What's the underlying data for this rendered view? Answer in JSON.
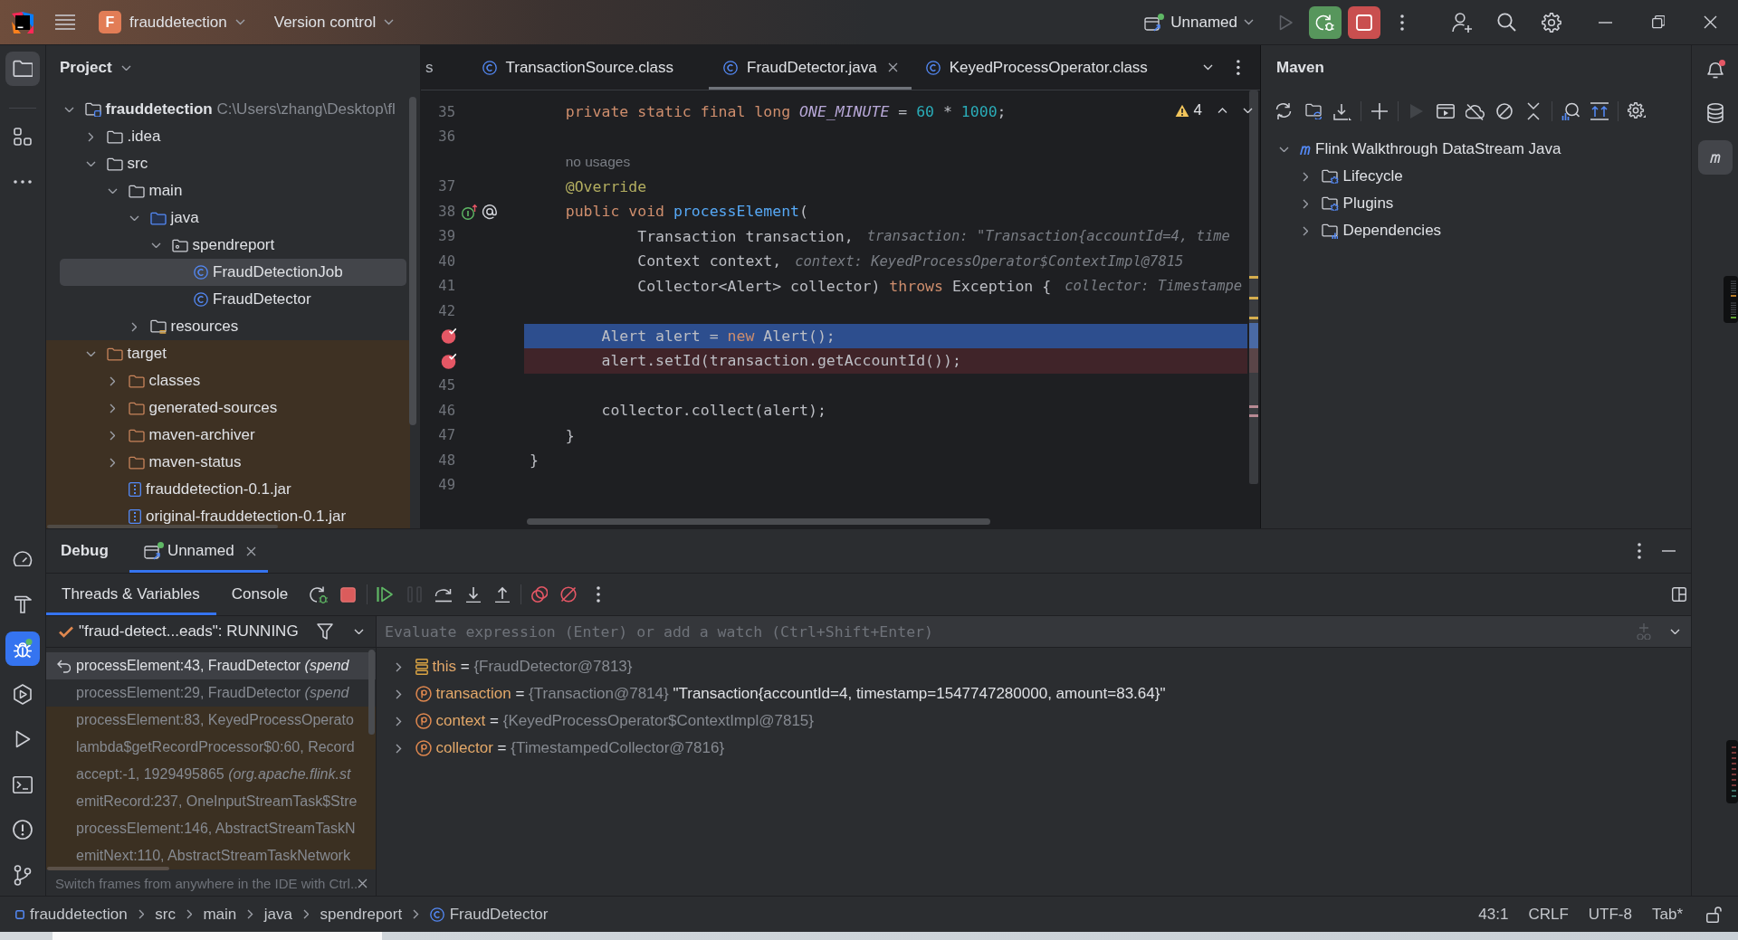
{
  "title_bar": {
    "project_badge": "F",
    "project": "frauddetection",
    "vcs": "Version control",
    "run_config": "Unnamed",
    "run_actions": [
      {
        "kind": "run",
        "disabled": true
      },
      {
        "kind": "debug",
        "disabled": false
      },
      {
        "kind": "stop",
        "disabled": false
      }
    ]
  },
  "left_toolbar": {
    "top": [
      {
        "kind": "project",
        "selected": true
      },
      {
        "kind": "structure",
        "selected": false
      },
      {
        "kind": "more",
        "selected": false
      }
    ],
    "bottom": [
      {
        "kind": "profiler",
        "selected": false
      },
      {
        "kind": "build",
        "selected": false
      },
      {
        "kind": "debug",
        "selected": true
      },
      {
        "kind": "services",
        "selected": false
      },
      {
        "kind": "run",
        "selected": false
      },
      {
        "kind": "terminal",
        "selected": false
      },
      {
        "kind": "problems",
        "selected": false
      },
      {
        "kind": "git",
        "selected": false
      }
    ]
  },
  "project": {
    "title": "Project",
    "tree": [
      {
        "label": "frauddetection",
        "path": "C:\\Users\\zhang\\Desktop\\fl",
        "kind": "module",
        "expanded": true,
        "selected": false,
        "excluded": false,
        "children": [
          {
            "label": ".idea",
            "kind": "folder",
            "expanded": false,
            "selected": false,
            "excluded": false
          },
          {
            "label": "src",
            "kind": "folder",
            "expanded": true,
            "selected": false,
            "excluded": false,
            "children": [
              {
                "label": "main",
                "kind": "folder",
                "expanded": true,
                "selected": false,
                "excluded": false,
                "children": [
                  {
                    "label": "java",
                    "kind": "source",
                    "expanded": true,
                    "selected": false,
                    "excluded": false,
                    "children": [
                      {
                        "label": "spendreport",
                        "kind": "package",
                        "expanded": true,
                        "selected": false,
                        "excluded": false,
                        "children": [
                          {
                            "label": "FraudDetectionJob",
                            "kind": "class",
                            "selected": true,
                            "excluded": false
                          },
                          {
                            "label": "FraudDetector",
                            "kind": "class",
                            "selected": false,
                            "excluded": false
                          }
                        ]
                      }
                    ]
                  },
                  {
                    "label": "resources",
                    "kind": "resources",
                    "expanded": false,
                    "selected": false,
                    "excluded": false
                  }
                ]
              }
            ]
          },
          {
            "label": "target",
            "kind": "folder",
            "expanded": true,
            "selected": false,
            "excluded": true,
            "children": [
              {
                "label": "classes",
                "kind": "folder",
                "expanded": false,
                "selected": false,
                "excluded": true
              },
              {
                "label": "generated-sources",
                "kind": "folder",
                "expanded": false,
                "selected": false,
                "excluded": true
              },
              {
                "label": "maven-archiver",
                "kind": "folder",
                "expanded": false,
                "selected": false,
                "excluded": true
              },
              {
                "label": "maven-status",
                "kind": "folder",
                "expanded": false,
                "selected": false,
                "excluded": true
              },
              {
                "label": "frauddetection-0.1.jar",
                "kind": "jar",
                "selected": false,
                "excluded": true
              },
              {
                "label": "original-frauddetection-0.1.jar",
                "kind": "jar",
                "selected": false,
                "excluded": true
              }
            ]
          }
        ]
      }
    ]
  },
  "editor": {
    "tabs": [
      {
        "label": "s",
        "kind": "partial",
        "selected": false
      },
      {
        "label": "TransactionSource.class",
        "kind": "class",
        "selected": false
      },
      {
        "label": "FraudDetector.java",
        "kind": "class",
        "selected": true
      },
      {
        "label": "KeyedProcessOperator.class",
        "kind": "class",
        "selected": false
      }
    ],
    "warnings": "4",
    "lines": [
      {
        "kind": "code",
        "number": "35",
        "breakpoint": false,
        "current": false,
        "override_marker": false,
        "tokens": [
          {
            "kind": "keyword",
            "text": "    private static final long "
          },
          {
            "kind": "constant",
            "text": "ONE_MINUTE"
          },
          {
            "kind": "plain",
            "text": " = "
          },
          {
            "kind": "number",
            "text": "60"
          },
          {
            "kind": "plain",
            "text": " * "
          },
          {
            "kind": "number",
            "text": "1000"
          },
          {
            "kind": "plain",
            "text": ";"
          }
        ]
      },
      {
        "kind": "code",
        "number": "36",
        "breakpoint": false,
        "current": false,
        "override_marker": false
      },
      {
        "kind": "inlay",
        "text": "no usages"
      },
      {
        "kind": "code",
        "number": "37",
        "breakpoint": false,
        "current": false,
        "override_marker": false,
        "tokens": [
          {
            "kind": "annotation",
            "text": "    @Override"
          }
        ]
      },
      {
        "kind": "code",
        "number": "38",
        "breakpoint": false,
        "current": false,
        "override_marker": true,
        "tokens": [
          {
            "kind": "keyword",
            "text": "    public void "
          },
          {
            "kind": "method",
            "text": "processElement"
          },
          {
            "kind": "plain",
            "text": "("
          }
        ]
      },
      {
        "kind": "code",
        "number": "39",
        "breakpoint": false,
        "current": false,
        "override_marker": false,
        "tokens": [
          {
            "kind": "plain",
            "text": "            Transaction transaction,"
          }
        ],
        "hint": "transaction: \"Transaction{accountId=4, time"
      },
      {
        "kind": "code",
        "number": "40",
        "breakpoint": false,
        "current": false,
        "override_marker": false,
        "tokens": [
          {
            "kind": "plain",
            "text": "            Context context,"
          }
        ],
        "hint": "context: KeyedProcessOperator$ContextImpl@7815"
      },
      {
        "kind": "code",
        "number": "41",
        "breakpoint": false,
        "current": false,
        "override_marker": false,
        "tokens": [
          {
            "kind": "plain",
            "text": "            Collector<Alert> collector) "
          },
          {
            "kind": "keyword",
            "text": "throws"
          },
          {
            "kind": "plain",
            "text": " Exception {"
          }
        ],
        "hint": "collector: Timestampe"
      },
      {
        "kind": "code",
        "number": "42",
        "breakpoint": false,
        "current": false,
        "override_marker": false
      },
      {
        "kind": "code",
        "breakpoint": true,
        "current": true,
        "override_marker": false,
        "tokens": [
          {
            "kind": "plain",
            "text": "        Alert alert = "
          },
          {
            "kind": "keyword",
            "text": "new"
          },
          {
            "kind": "plain",
            "text": " Alert();"
          }
        ]
      },
      {
        "kind": "code",
        "breakpoint": true,
        "current": false,
        "override_marker": false,
        "tokens": [
          {
            "kind": "plain",
            "text": "        alert.setId(transaction.getAccountId());"
          }
        ]
      },
      {
        "kind": "code",
        "number": "45",
        "breakpoint": false,
        "current": false,
        "override_marker": false
      },
      {
        "kind": "code",
        "number": "46",
        "breakpoint": false,
        "current": false,
        "override_marker": false,
        "tokens": [
          {
            "kind": "plain",
            "text": "        collector.collect(alert);"
          }
        ]
      },
      {
        "kind": "code",
        "number": "47",
        "breakpoint": false,
        "current": false,
        "override_marker": false,
        "tokens": [
          {
            "kind": "plain",
            "text": "    }"
          }
        ]
      },
      {
        "kind": "code",
        "number": "48",
        "breakpoint": false,
        "current": false,
        "override_marker": false,
        "tokens": [
          {
            "kind": "plain",
            "text": "}"
          }
        ]
      },
      {
        "kind": "code",
        "number": "49",
        "breakpoint": false,
        "current": false,
        "override_marker": false
      }
    ]
  },
  "maven": {
    "title": "Maven",
    "toolbar": [
      [
        {
          "kind": "reload",
          "disabled": false
        },
        {
          "kind": "reimport",
          "disabled": false
        },
        {
          "kind": "download",
          "disabled": false
        }
      ],
      [
        {
          "kind": "add",
          "disabled": false
        }
      ],
      [
        {
          "kind": "run",
          "disabled": true
        },
        {
          "kind": "execute",
          "disabled": false
        },
        {
          "kind": "offline",
          "disabled": false
        },
        {
          "kind": "skip",
          "disabled": false
        },
        {
          "kind": "collapse",
          "disabled": false
        }
      ],
      [
        {
          "kind": "analyze",
          "disabled": false
        },
        {
          "kind": "deps",
          "disabled": false
        }
      ],
      [
        {
          "kind": "settings",
          "disabled": false
        }
      ]
    ],
    "tree": [
      {
        "label": "Flink Walkthrough DataStream Java",
        "kind": "project",
        "expanded": true,
        "selected": false,
        "children": [
          {
            "label": "Lifecycle",
            "kind": "lifecycle",
            "expanded": false,
            "selected": false
          },
          {
            "label": "Plugins",
            "kind": "plugins",
            "expanded": false,
            "selected": false
          },
          {
            "label": "Dependencies",
            "kind": "dependencies",
            "expanded": false,
            "selected": false
          }
        ]
      }
    ]
  },
  "right_toolbar": [
    {
      "kind": "notifications",
      "badge": true,
      "selected": false
    },
    {
      "kind": "database",
      "badge": false,
      "selected": false
    },
    {
      "kind": "maven",
      "badge": false,
      "selected": true
    }
  ],
  "debug": {
    "title": "Debug",
    "sessions": [
      {
        "label": "Unnamed",
        "selected": true
      }
    ],
    "views": [
      {
        "label": "Threads & Variables",
        "selected": true
      },
      {
        "label": "Console",
        "selected": false
      }
    ],
    "toolbar": [
      [
        {
          "kind": "rerun",
          "disabled": false
        },
        {
          "kind": "stop",
          "disabled": false
        }
      ],
      [
        {
          "kind": "resume",
          "disabled": false
        },
        {
          "kind": "pause",
          "disabled": true
        },
        {
          "kind": "stepover",
          "disabled": false
        },
        {
          "kind": "stepinto",
          "disabled": false
        },
        {
          "kind": "stepout",
          "disabled": false
        }
      ],
      [
        {
          "kind": "breakpoints",
          "disabled": false
        },
        {
          "kind": "mute",
          "disabled": false
        },
        {
          "kind": "more",
          "disabled": false
        }
      ]
    ],
    "thread": "\"fraud-detect...eads\": RUNNING",
    "frames": [
      {
        "text": "processElement:43, FraudDetector *(spend*",
        "selected": true,
        "library": false
      },
      {
        "text": "processElement:29, FraudDetector *(spend*",
        "selected": false,
        "library": false
      },
      {
        "text": "processElement:83, KeyedProcessOperato",
        "selected": false,
        "library": true
      },
      {
        "text": "lambda$getRecordProcessor$0:60, Record",
        "selected": false,
        "library": true
      },
      {
        "text": "accept:-1, 1929495865 *(org.apache.flink.st*",
        "selected": false,
        "library": true
      },
      {
        "text": "emitRecord:237, OneInputStreamTask$Stre",
        "selected": false,
        "library": true
      },
      {
        "text": "processElement:146, AbstractStreamTaskN",
        "selected": false,
        "library": true
      },
      {
        "text": "emitNext:110, AbstractStreamTaskNetwork",
        "selected": false,
        "library": true
      }
    ],
    "hint": "Switch frames from anywhere in the IDE with Ctrl..",
    "evaluate": {
      "placeholder": "Evaluate expression (Enter) or add a watch (Ctrl+Shift+Enter)"
    },
    "variables": [
      {
        "name": "this",
        "kind": "this",
        "sign": "=",
        "value": "{FraudDetector@7813}",
        "expanded": false
      },
      {
        "name": "transaction",
        "kind": "parameter",
        "sign": "=",
        "value": "{Transaction@7814}",
        "string": "\"Transaction{accountId=4, timestamp=1547747280000, amount=83.64}\"",
        "expanded": false
      },
      {
        "name": "context",
        "kind": "parameter",
        "sign": "=",
        "value": "{KeyedProcessOperator$ContextImpl@7815}",
        "expanded": false
      },
      {
        "name": "collector",
        "kind": "parameter",
        "sign": "=",
        "value": "{TimestampedCollector@7816}",
        "expanded": false
      }
    ]
  },
  "status_bar": {
    "breadcrumbs": [
      {
        "label": "frauddetection",
        "kind": "module"
      },
      {
        "label": "src",
        "kind": "folder"
      },
      {
        "label": "main",
        "kind": "folder"
      },
      {
        "label": "java",
        "kind": "folder"
      },
      {
        "label": "spendreport",
        "kind": "folder"
      },
      {
        "label": "FraudDetector",
        "kind": "class"
      }
    ],
    "items": [
      "43:1",
      "CRLF",
      "UTF-8",
      "Tab*"
    ]
  }
}
